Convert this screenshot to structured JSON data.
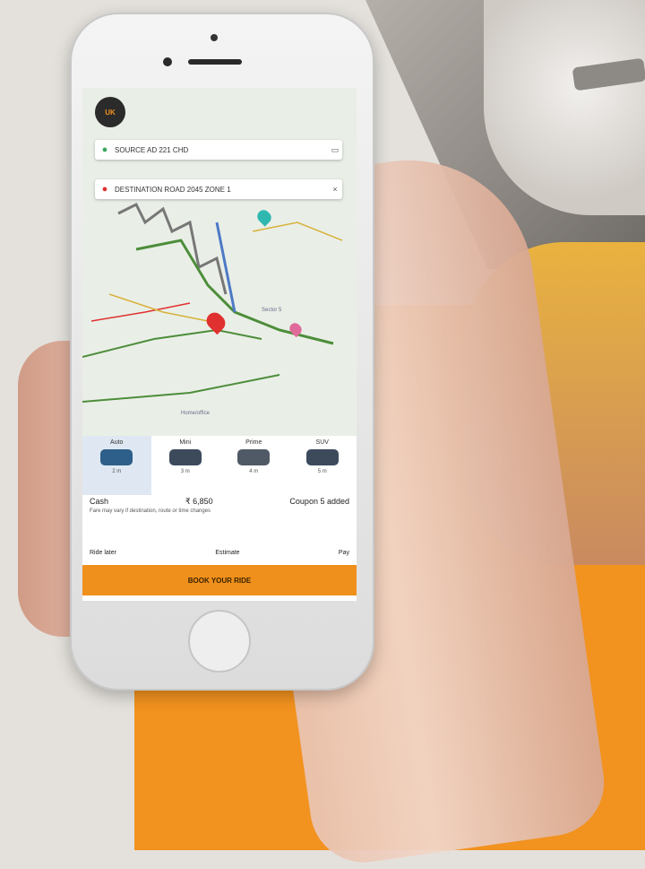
{
  "map": {
    "avatar": "UK",
    "pickup": "SOURCE AD 221 CHD",
    "destination": "DESTINATION ROAD 2045 ZONE 1",
    "labels": [
      "Home/office",
      "Sector 5"
    ]
  },
  "options": [
    {
      "label": "Auto",
      "eta": "2 m"
    },
    {
      "label": "Mini",
      "eta": "3 m"
    },
    {
      "label": "Prime",
      "eta": "4 m"
    },
    {
      "label": "SUV",
      "eta": "5 m"
    }
  ],
  "fare": {
    "cash": "Cash",
    "amount": "₹ 6,850",
    "coupon": "Coupon 5 added",
    "note": "Fare may vary if destination, route or time changes"
  },
  "extra": {
    "left": "Ride later",
    "mid": "Estimate",
    "right": "Pay"
  },
  "book_label": "BOOK YOUR RIDE",
  "colors": {
    "accent": "#f2921f",
    "route": "#4d8d3a",
    "pin": "#e0302f"
  }
}
